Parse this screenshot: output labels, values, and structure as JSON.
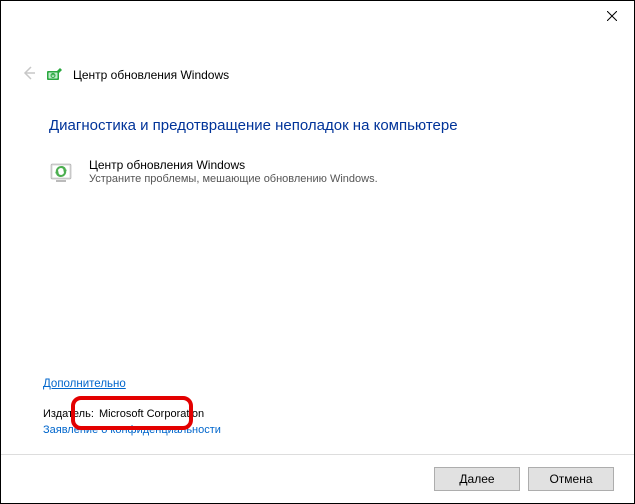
{
  "titlebar": {
    "close_icon": "close"
  },
  "nav": {
    "title": "Центр обновления Windows"
  },
  "content": {
    "heading": "Диагностика и предотвращение неполадок на компьютере",
    "item": {
      "title": "Центр обновления Windows",
      "desc": "Устраните проблемы, мешающие обновлению Windows."
    }
  },
  "footer_links": {
    "advanced": "Дополнительно",
    "publisher_label": "Издатель:",
    "publisher_value": "Microsoft Corporation",
    "privacy": "Заявление о конфиденциальности"
  },
  "buttons": {
    "next": "Далее",
    "cancel": "Отмена"
  }
}
